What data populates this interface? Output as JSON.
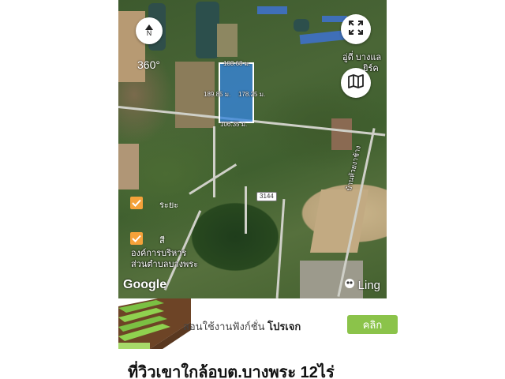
{
  "map": {
    "compass_label": "N",
    "view_360_label": "360°",
    "road_number": "3144",
    "provider_logo": "Google",
    "brand_logo": "Ling",
    "parcel_dimensions": {
      "top": "103.68 ม.",
      "left": "189.85 ม.",
      "right": "178.25 ม.",
      "bottom": "106.35 ม."
    },
    "poi_labels": {
      "top_right": "อู่ดี่ บางแล",
      "top_right_2": "ยิร์ค",
      "org_line1": "องค์การบริหาร",
      "org_line2": "ส่วนตำบลบางพระ",
      "road_side": "บ้านห้วยงาช้าง"
    },
    "layers": [
      {
        "label": "ระยะ",
        "checked": true
      },
      {
        "label": "สี",
        "checked": true
      }
    ],
    "icons": {
      "compass": "compass-icon",
      "fullscreen": "expand-icon",
      "map_type": "map-icon",
      "checkbox": "checkmark-icon",
      "ling": "ling-logo-icon"
    },
    "parcel_color": "#3484dc"
  },
  "ad_banner": {
    "text_prefix": "สอนใช้งานฟังก์ชั่น",
    "text_bold": "โปรเจก",
    "cta_label": "คลิก",
    "cta_color": "#8bc34a"
  },
  "listing": {
    "title": "ที่วิวเขาใกล้อบต.บางพระ 12ไร่"
  }
}
